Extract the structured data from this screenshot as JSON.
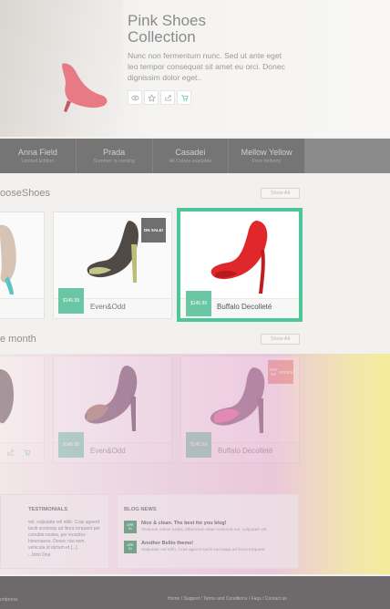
{
  "hero": {
    "title_line1": "Pink Shoes",
    "title_line2": "Collection",
    "description": "Nunc non fermentum nunc. Sed ut ante eget leo tempor consequat sit amet eu orci. Donec dignissim dolor eget..",
    "actions": [
      "eye-icon",
      "star-icon",
      "share-icon",
      "cart-icon"
    ]
  },
  "brands": [
    {
      "name": "Anna Field",
      "sub": "Limited Edition"
    },
    {
      "name": "Prada",
      "sub": "Summer is coming"
    },
    {
      "name": "Casadei",
      "sub": "All Colors available"
    },
    {
      "name": "Mellow Yellow",
      "sub": "Free delivery"
    }
  ],
  "section1": {
    "title": "ooseShoes",
    "show_all": "Show All"
  },
  "section2": {
    "title": "e month",
    "show_all": "Show All"
  },
  "products_row1": [
    {
      "name": "Even&Odd",
      "price": "$145.99",
      "badge": "ON SALE!"
    },
    {
      "name": "Buffalo Decolleté",
      "price": "$145.99"
    }
  ],
  "products_row2": [
    {
      "name": "Even&Odd",
      "price": "$145.99"
    },
    {
      "name": "Buffalo Decolleté",
      "price": "$145.99",
      "badge_line1": "OUT OF",
      "badge_line2": "STOCK"
    }
  ],
  "testimonials": {
    "title": "TESTIMONIALS",
    "text": "vel, vulputate vel nibh. Cras agnent taciti sociosqu ad litora torquent per conubia nostra, per inceptos himenaeos. Donec nisi sem, vehicula id dictum et [...]",
    "author": "- John Doe"
  },
  "blog": {
    "title": "BLOG NEWS",
    "posts": [
      {
        "date_top": "APR",
        "date_bottom": "01",
        "title": "Nice & clean. The best for you blog!",
        "excerpt": "Vivamus metus turpis, bibendum vitae euismod vel, vulputate vel"
      },
      {
        "date_top": "APR",
        "date_bottom": "01",
        "title": "Another Bellio theme!",
        "excerpt": "Vulputate vel nibh. Cras agnent taciti sociosqu ad litora torquent"
      }
    ]
  },
  "footer": {
    "copyright": "ordpress",
    "links": "Home / Support / Terms and Conditions / Faqs / Contact us"
  },
  "colors": {
    "accent": "#4dc79a",
    "price": "#6ac6a5",
    "out_of_stock": "#e88b7b",
    "brandbar": "#757575"
  }
}
